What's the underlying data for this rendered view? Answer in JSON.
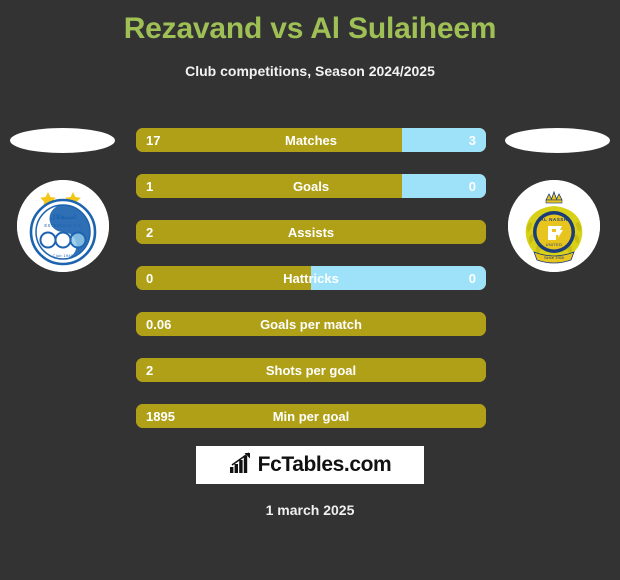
{
  "header": {
    "title": "Rezavand vs Al Sulaiheem",
    "subtitle": "Club competitions, Season 2024/2025",
    "title_color": "#9FC054"
  },
  "teams": {
    "home": {
      "crest_name": "esteghlal-crest",
      "crest_text_top": "استقلال",
      "crest_text_mid": "ESTEGHLAL F.C",
      "crest_text_bottom": "Club 1945"
    },
    "away": {
      "crest_name": "al-nassr-crest",
      "crest_text_top": "AL NASSR",
      "crest_text_mid": "UNITED",
      "crest_text_bottom": "Since 1955"
    }
  },
  "colors": {
    "background": "#333333",
    "bar_left": "#B0A018",
    "bar_right": "#9DE2F8",
    "accent": "#9FC054"
  },
  "stats": [
    {
      "label": "Matches",
      "left": "17",
      "right": "3",
      "left_pct": 76,
      "has_right": true
    },
    {
      "label": "Goals",
      "left": "1",
      "right": "0",
      "left_pct": 76,
      "has_right": true
    },
    {
      "label": "Assists",
      "left": "2",
      "right": "",
      "left_pct": 100,
      "has_right": false
    },
    {
      "label": "Hattricks",
      "left": "0",
      "right": "0",
      "left_pct": 50,
      "has_right": true
    },
    {
      "label": "Goals per match",
      "left": "0.06",
      "right": "",
      "left_pct": 100,
      "has_right": false
    },
    {
      "label": "Shots per goal",
      "left": "2",
      "right": "",
      "left_pct": 100,
      "has_right": false
    },
    {
      "label": "Min per goal",
      "left": "1895",
      "right": "",
      "left_pct": 100,
      "has_right": false
    }
  ],
  "footer": {
    "logo_text": "FcTables.com",
    "logo_icon": "bar-chart-arrow-icon",
    "date": "1 march 2025"
  }
}
